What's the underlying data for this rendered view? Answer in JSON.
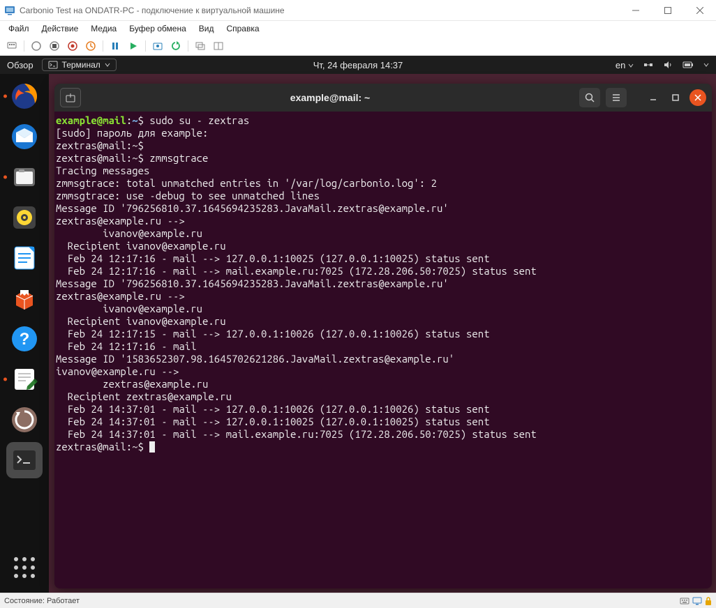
{
  "window": {
    "title": "Carbonio Test на ONDATR-PC - подключение к виртуальной машине",
    "menubar": [
      "Файл",
      "Действие",
      "Медиа",
      "Буфер обмена",
      "Вид",
      "Справка"
    ]
  },
  "ubuntu": {
    "activities": "Обзор",
    "term_label": "Терминал",
    "datetime": "Чт, 24 февраля  14:37",
    "lang_indicator": "en"
  },
  "terminal": {
    "title": "example@mail: ~",
    "lines": [
      {
        "segments": [
          {
            "c": "p-user",
            "t": "example@mail"
          },
          {
            "c": "p-white",
            "t": ":"
          },
          {
            "c": "p-path",
            "t": "~"
          },
          {
            "c": "p-white",
            "t": "$ sudo su - zextras"
          }
        ]
      },
      {
        "segments": [
          {
            "c": "p-white",
            "t": "[sudo] пароль для example:"
          }
        ]
      },
      {
        "segments": [
          {
            "c": "p-white",
            "t": "zextras@mail:~$"
          }
        ]
      },
      {
        "segments": [
          {
            "c": "p-white",
            "t": "zextras@mail:~$ zmmsgtrace"
          }
        ]
      },
      {
        "segments": [
          {
            "c": "p-white",
            "t": "Tracing messages"
          }
        ]
      },
      {
        "segments": [
          {
            "c": "p-white",
            "t": ""
          }
        ]
      },
      {
        "segments": [
          {
            "c": "p-white",
            "t": "zmmsgtrace: total unmatched entries in '/var/log/carbonio.log': 2"
          }
        ]
      },
      {
        "segments": [
          {
            "c": "p-white",
            "t": "zmmsgtrace: use -debug to see unmatched lines"
          }
        ]
      },
      {
        "segments": [
          {
            "c": "p-white",
            "t": "Message ID '796256810.37.1645694235283.JavaMail.zextras@example.ru'"
          }
        ]
      },
      {
        "segments": [
          {
            "c": "p-white",
            "t": "zextras@example.ru -->"
          }
        ]
      },
      {
        "segments": [
          {
            "c": "p-白",
            "t": "        ivanov@example.ru"
          }
        ]
      },
      {
        "segments": [
          {
            "c": "p-white",
            "t": "  Recipient ivanov@example.ru"
          }
        ]
      },
      {
        "segments": [
          {
            "c": "p-white",
            "t": "  Feb 24 12:17:16 - mail --> 127.0.0.1:10025 (127.0.0.1:10025) status sent"
          }
        ]
      },
      {
        "segments": [
          {
            "c": "p-white",
            "t": "  Feb 24 12:17:16 - mail --> mail.example.ru:7025 (172.28.206.50:7025) status sent"
          }
        ]
      },
      {
        "segments": [
          {
            "c": "p-white",
            "t": ""
          }
        ]
      },
      {
        "segments": [
          {
            "c": "p-white",
            "t": "Message ID '796256810.37.1645694235283.JavaMail.zextras@example.ru'"
          }
        ]
      },
      {
        "segments": [
          {
            "c": "p-white",
            "t": "zextras@example.ru -->"
          }
        ]
      },
      {
        "segments": [
          {
            "c": "p-white",
            "t": "        ivanov@example.ru"
          }
        ]
      },
      {
        "segments": [
          {
            "c": "p-white",
            "t": "  Recipient ivanov@example.ru"
          }
        ]
      },
      {
        "segments": [
          {
            "c": "p-white",
            "t": "  Feb 24 12:17:15 - mail --> 127.0.0.1:10026 (127.0.0.1:10026) status sent"
          }
        ]
      },
      {
        "segments": [
          {
            "c": "p-white",
            "t": "  Feb 24 12:17:16 - mail"
          }
        ]
      },
      {
        "segments": [
          {
            "c": "p-white",
            "t": ""
          }
        ]
      },
      {
        "segments": [
          {
            "c": "p-white",
            "t": "Message ID '1583652307.98.1645702621286.JavaMail.zextras@example.ru'"
          }
        ]
      },
      {
        "segments": [
          {
            "c": "p-white",
            "t": "ivanov@example.ru -->"
          }
        ]
      },
      {
        "segments": [
          {
            "c": "p-white",
            "t": "        zextras@example.ru"
          }
        ]
      },
      {
        "segments": [
          {
            "c": "p-white",
            "t": "  Recipient zextras@example.ru"
          }
        ]
      },
      {
        "segments": [
          {
            "c": "p-white",
            "t": "  Feb 24 14:37:01 - mail --> 127.0.0.1:10026 (127.0.0.1:10026) status sent"
          }
        ]
      },
      {
        "segments": [
          {
            "c": "p-white",
            "t": "  Feb 24 14:37:01 - mail --> 127.0.0.1:10025 (127.0.0.1:10025) status sent"
          }
        ]
      },
      {
        "segments": [
          {
            "c": "p-white",
            "t": "  Feb 24 14:37:01 - mail --> mail.example.ru:7025 (172.28.206.50:7025) status sent"
          }
        ]
      },
      {
        "segments": [
          {
            "c": "p-white",
            "t": ""
          }
        ]
      },
      {
        "segments": [
          {
            "c": "p-white",
            "t": "zextras@mail:~$ "
          }
        ],
        "cursor": true
      }
    ]
  },
  "statusbar": {
    "text": "Состояние: Работает"
  }
}
